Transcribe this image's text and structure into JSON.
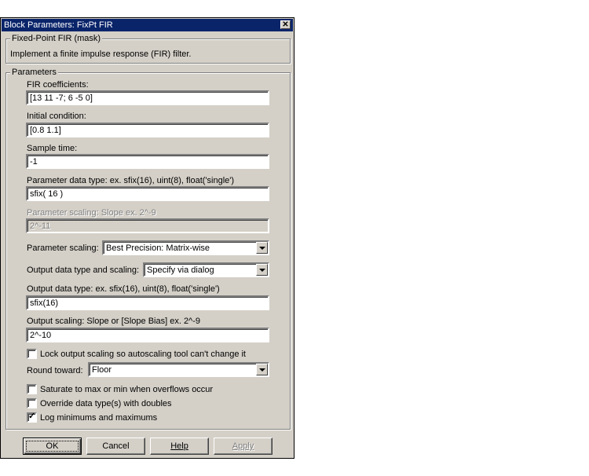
{
  "window": {
    "title": "Block Parameters: FixPt FIR",
    "close_glyph": "✕"
  },
  "mask": {
    "legend": "Fixed-Point FIR (mask)",
    "description": "Implement a finite impulse response (FIR) filter."
  },
  "params": {
    "legend": "Parameters",
    "fir_coefficients": {
      "label": "FIR coefficients:",
      "value": "[13 11 -7; 6 -5 0]"
    },
    "initial_condition": {
      "label": "Initial condition:",
      "value": "[0.8 1.1]"
    },
    "sample_time": {
      "label": "Sample time:",
      "value": "-1"
    },
    "param_data_type": {
      "label": "Parameter data type:    ex. sfix(16),  uint(8),  float('single')",
      "value": "sfix( 16 )"
    },
    "param_scaling_text": {
      "label": "Parameter scaling:   Slope   ex.  2^-9",
      "value": "2^-11"
    },
    "param_scaling_mode": {
      "label": "Parameter scaling:",
      "value": "Best Precision: Matrix-wise"
    },
    "output_dt_scaling": {
      "label": "Output data type and scaling:",
      "value": "Specify via dialog"
    },
    "output_data_type": {
      "label": "Output data type:    ex.  sfix(16),  uint(8),  float('single')",
      "value": "sfix(16)"
    },
    "output_scaling": {
      "label": "Output scaling:   Slope or [Slope Bias]   ex.  2^-9",
      "value": "2^-10"
    },
    "lock_scaling": {
      "label": "Lock output scaling so autoscaling tool can't change it",
      "checked": false
    },
    "round_toward": {
      "label": "Round toward:",
      "value": "Floor"
    },
    "saturate": {
      "label": "Saturate to max or min when overflows occur",
      "checked": false
    },
    "override_doubles": {
      "label": "Override data type(s) with doubles",
      "checked": false
    },
    "log_minmax": {
      "label": "Log minimums and maximums",
      "checked": true,
      "mark": "✓"
    }
  },
  "buttons": {
    "ok": "OK",
    "cancel": "Cancel",
    "help": "Help",
    "apply": "Apply"
  }
}
